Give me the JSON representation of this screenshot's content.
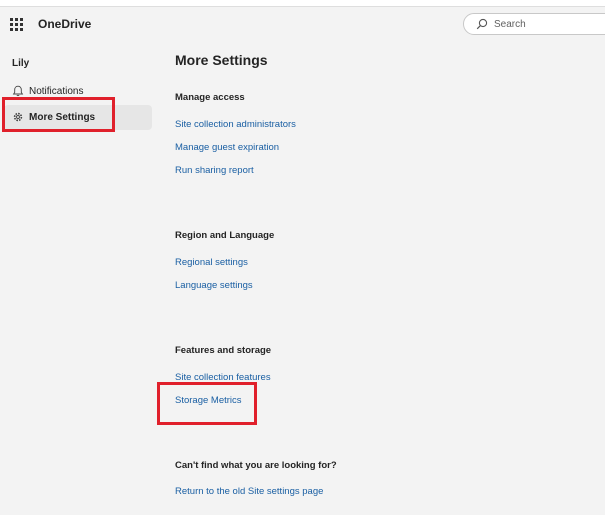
{
  "header": {
    "app_name": "OneDrive",
    "search_placeholder": "Search"
  },
  "sidebar": {
    "user_name": "Lily",
    "items": [
      {
        "label": "Notifications",
        "icon": "bell-icon",
        "selected": false
      },
      {
        "label": "More Settings",
        "icon": "gear-icon",
        "selected": true
      }
    ]
  },
  "main": {
    "title": "More Settings",
    "sections": [
      {
        "heading": "Manage access",
        "links": [
          "Site collection administrators",
          "Manage guest expiration",
          "Run sharing report"
        ]
      },
      {
        "heading": "Region and Language",
        "links": [
          "Regional settings",
          "Language settings"
        ]
      },
      {
        "heading": "Features and storage",
        "links": [
          "Site collection features",
          "Storage Metrics"
        ]
      },
      {
        "heading": "Can't find what you are looking for?",
        "links": [
          "Return to the old Site settings page"
        ]
      }
    ]
  },
  "colors": {
    "link": "#1a5fa3",
    "highlight": "#e0202b",
    "background": "#f3f3f3"
  }
}
